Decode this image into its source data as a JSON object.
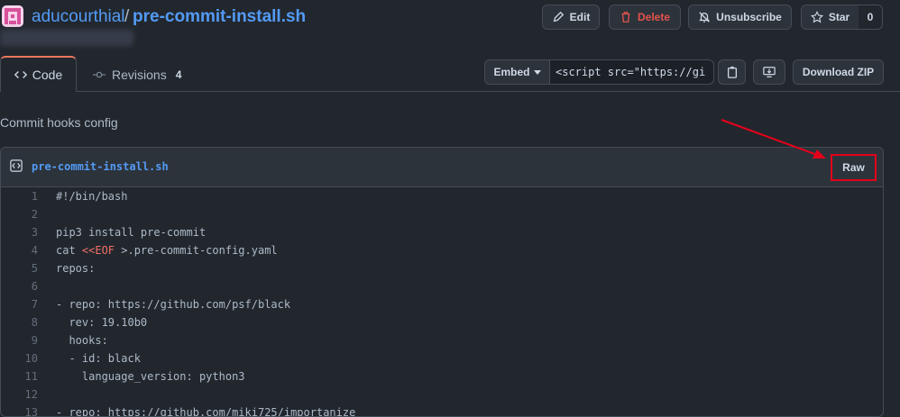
{
  "header": {
    "owner": "aducourthial",
    "separator": "/",
    "filename": "pre-commit-install.sh",
    "actions": {
      "edit": "Edit",
      "delete": "Delete",
      "unsubscribe": "Unsubscribe",
      "star": "Star",
      "star_count": "0"
    }
  },
  "tabs": {
    "code": "Code",
    "revisions": "Revisions",
    "revisions_count": "4"
  },
  "toolbar": {
    "embed": "Embed",
    "embed_value": "<script src=\"https://gi",
    "download": "Download ZIP"
  },
  "description": "Commit hooks config",
  "file": {
    "name": "pre-commit-install.sh",
    "raw": "Raw",
    "lines": [
      {
        "n": "1",
        "text": "#!/bin/bash"
      },
      {
        "n": "2",
        "text": ""
      },
      {
        "n": "3",
        "text": "pip3 install pre-commit"
      },
      {
        "n": "4",
        "pre": "cat ",
        "kw": "<<EOF",
        "post": " >.pre-commit-config.yaml"
      },
      {
        "n": "5",
        "text": "repos:"
      },
      {
        "n": "6",
        "text": ""
      },
      {
        "n": "7",
        "text": "- repo: https://github.com/psf/black"
      },
      {
        "n": "8",
        "text": "  rev: 19.10b0"
      },
      {
        "n": "9",
        "text": "  hooks:"
      },
      {
        "n": "10",
        "text": "  - id: black"
      },
      {
        "n": "11",
        "text": "    language_version: python3"
      },
      {
        "n": "12",
        "text": ""
      },
      {
        "n": "13",
        "text": "- repo: https://github.com/miki725/importanize"
      }
    ]
  },
  "colors": {
    "accent": "#539bf5",
    "danger": "#e5534b",
    "annotation": "#e5001a",
    "background": "#22272e"
  }
}
